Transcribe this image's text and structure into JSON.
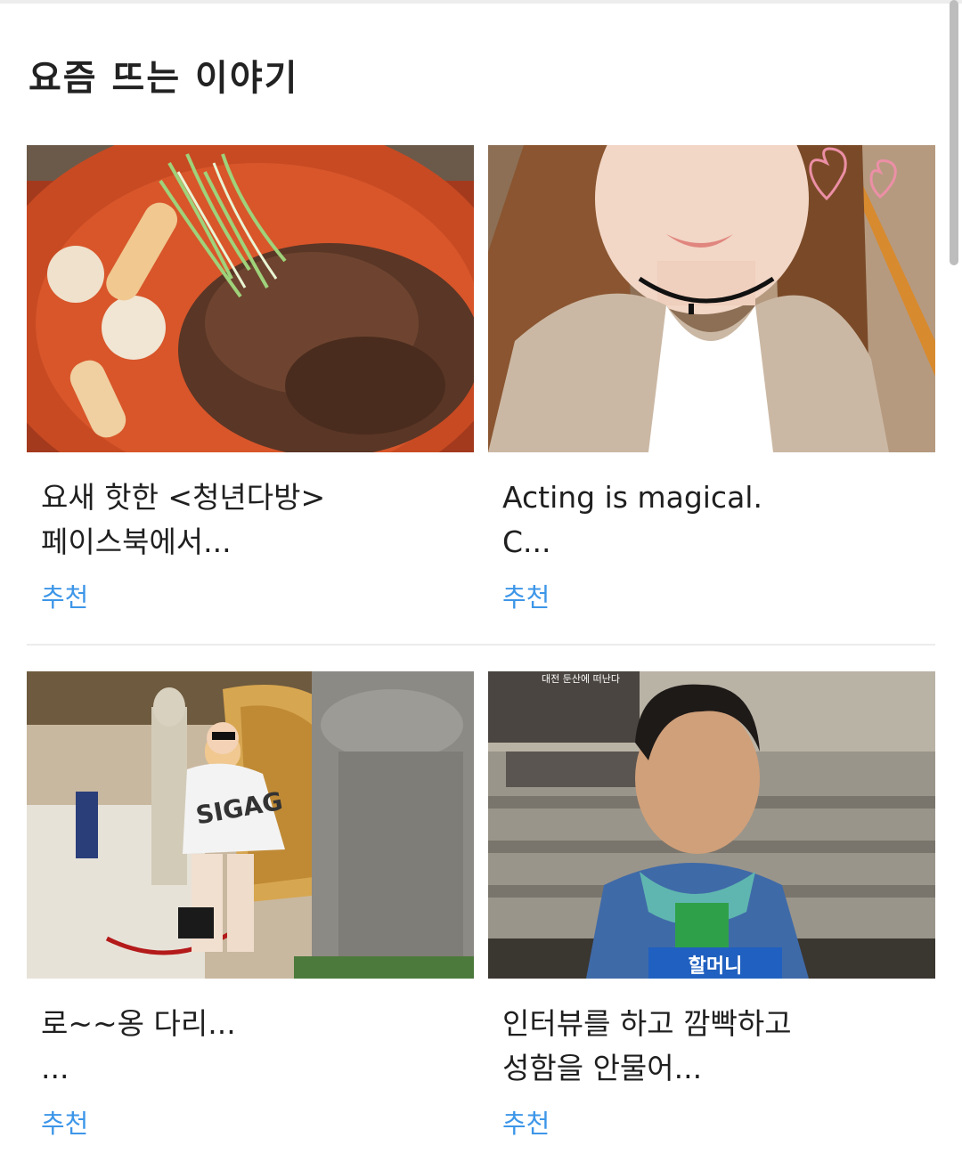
{
  "section": {
    "title": "요즘 뜨는 이야기"
  },
  "cards": [
    {
      "title": "요새 핫한 <청년다방>\n페이스북에서...",
      "tag": "추천",
      "image": "spicy-tteokbokki-photo"
    },
    {
      "title": "Acting is magical.\nC...",
      "tag": "추천",
      "image": "woman-selfie-photo"
    },
    {
      "title": "로~~옹 다리...\n...",
      "tag": "추천",
      "image": "woman-posing-statue-photo"
    },
    {
      "title": "인터뷰를 하고 깜빡하고\n성함을 안물어...",
      "tag": "추천",
      "image": "elderly-woman-interview-photo"
    }
  ],
  "overlays": {
    "card4_caption": "할머니",
    "card4_banner": "대전 둔산에 떠난다"
  },
  "colors": {
    "accent": "#3d96e8",
    "divider": "#ececec",
    "text": "#1f1f1f"
  }
}
